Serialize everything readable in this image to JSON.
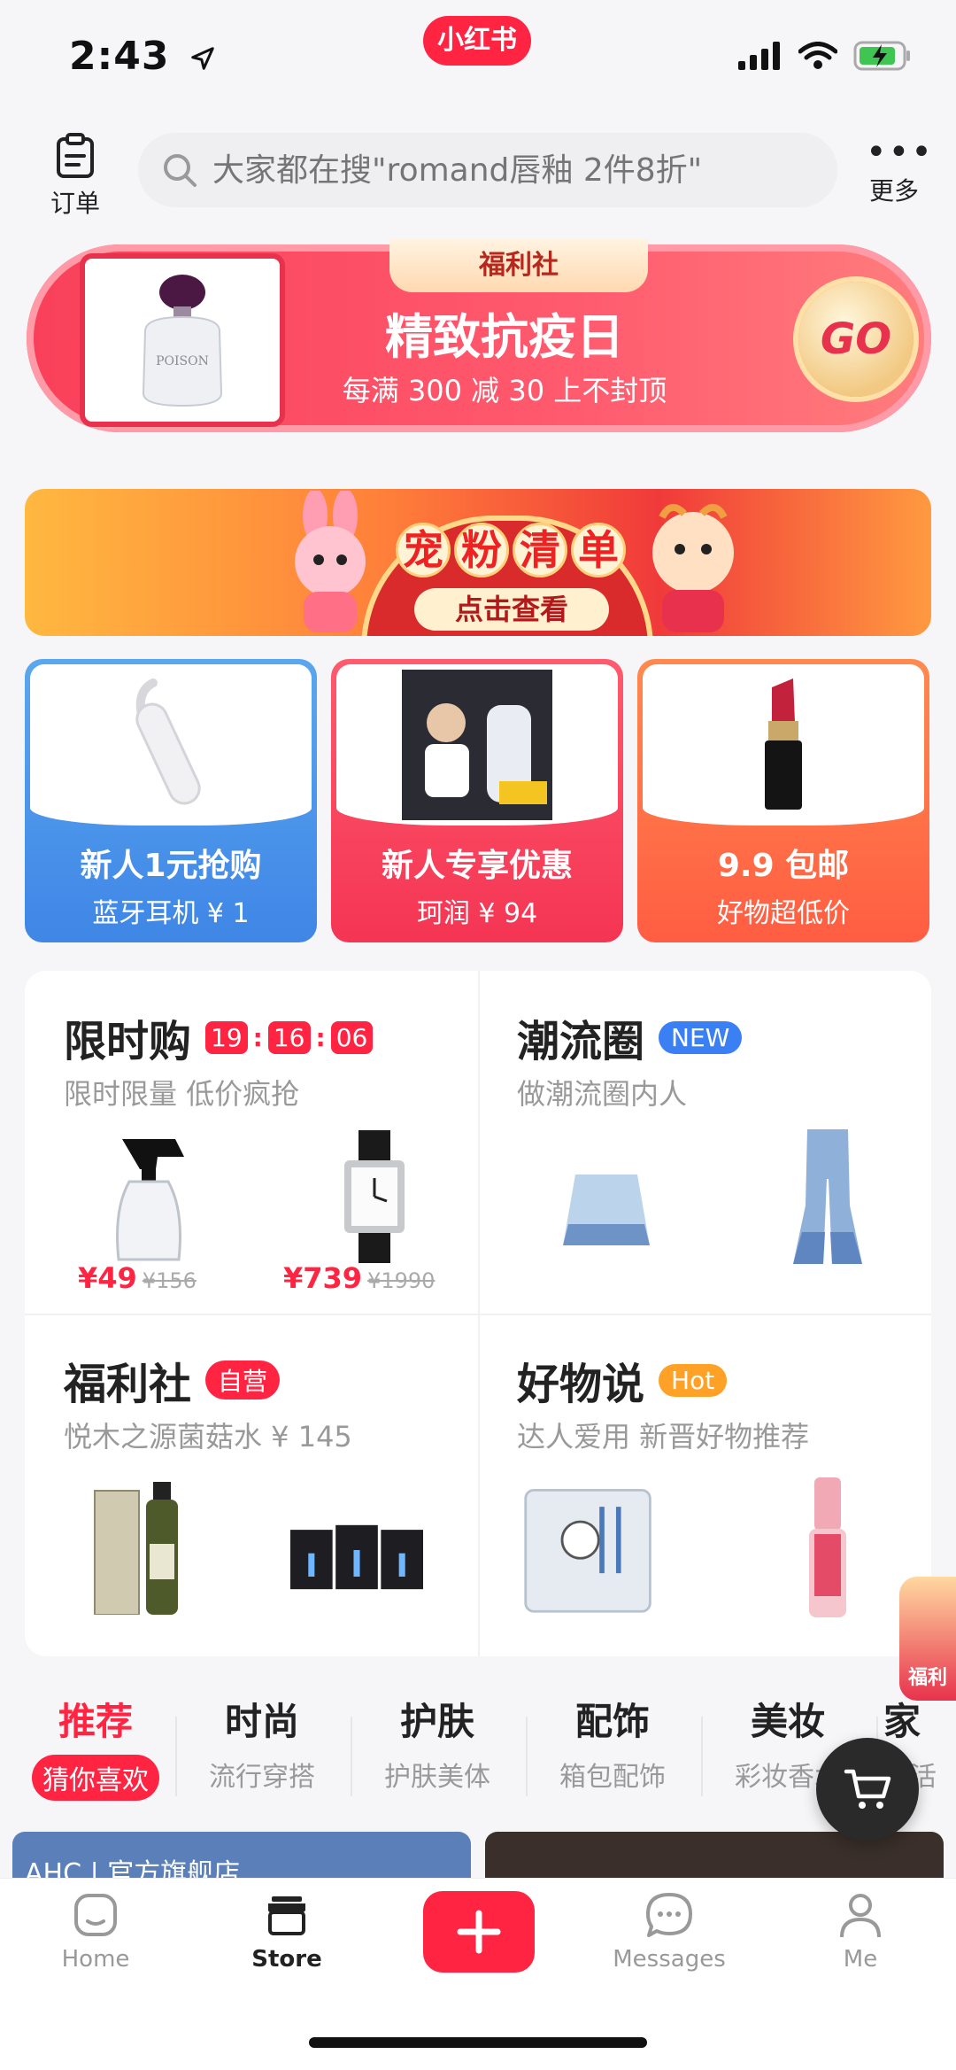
{
  "status": {
    "time": "2:43",
    "app_badge": "小红书"
  },
  "topbar": {
    "orders_label": "订单",
    "search_placeholder": "大家都在搜\"romand唇釉 2件8折\"",
    "more_label": "更多"
  },
  "welfare_banner": {
    "tag": "福利社",
    "title": "精致抗疫日",
    "subtitle": "每满 300 减 30 上不封顶",
    "go": "GO",
    "product_brand": "POISON"
  },
  "pet_banner": {
    "line1": [
      "宠",
      "粉",
      "清",
      "单"
    ],
    "line2": "点击查看"
  },
  "promos": [
    {
      "title": "新人1元抢购",
      "subtitle": "蓝牙耳机 ¥ 1"
    },
    {
      "title": "新人专享优惠",
      "subtitle": "珂润 ¥ 94"
    },
    {
      "title": "9.9 包邮",
      "subtitle": "好物超低价"
    }
  ],
  "features": {
    "flash": {
      "title": "限时购",
      "timer": [
        "19",
        "16",
        "06"
      ],
      "desc": "限时限量 低价疯抢",
      "items": [
        {
          "price": "¥49",
          "original": "¥156"
        },
        {
          "price": "¥739",
          "original": "¥1990"
        }
      ]
    },
    "trend": {
      "title": "潮流圈",
      "badge": "NEW",
      "desc": "做潮流圈内人"
    },
    "welfare": {
      "title": "福利社",
      "badge": "自营",
      "desc": "悦木之源菌菇水 ¥ 145"
    },
    "goods": {
      "title": "好物说",
      "badge": "Hot",
      "desc": "达人爱用 新晋好物推荐"
    }
  },
  "categories": [
    {
      "title": "推荐",
      "sub": "猜你喜欢",
      "active": true
    },
    {
      "title": "时尚",
      "sub": "流行穿搭"
    },
    {
      "title": "护肤",
      "sub": "护肤美体"
    },
    {
      "title": "配饰",
      "sub": "箱包配饰"
    },
    {
      "title": "美妆",
      "sub": "彩妆香水"
    },
    {
      "title": "家",
      "sub": "生活"
    }
  ],
  "feed": {
    "left_store": "AHC | 官方旗舰店"
  },
  "side_gift": "福利",
  "tabbar": [
    {
      "label": "Home"
    },
    {
      "label": "Store",
      "active": true
    },
    {
      "label": "Messages"
    },
    {
      "label": "Me"
    }
  ],
  "colors": {
    "brand": "#ff2442",
    "accent_blue": "#3a7ff4",
    "hot_orange": "#ffa126"
  }
}
